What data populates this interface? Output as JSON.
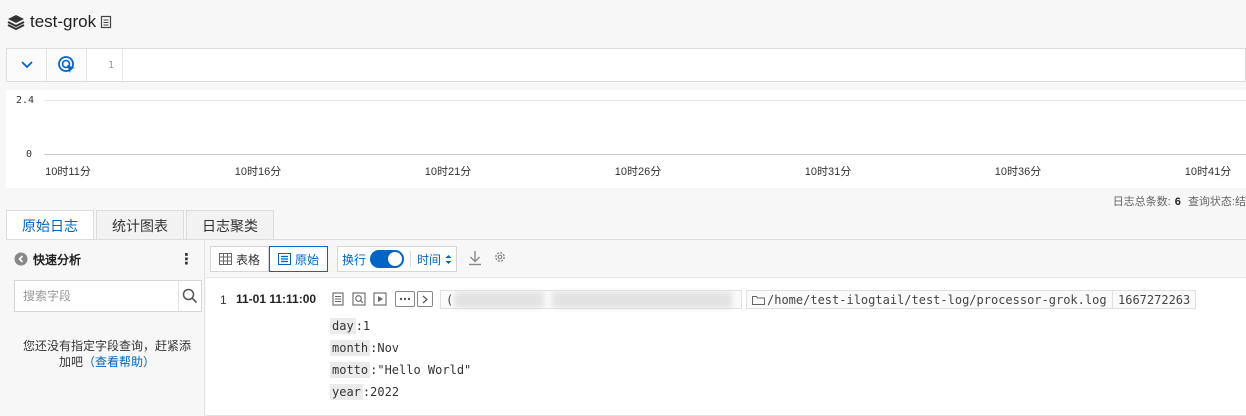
{
  "header": {
    "title": "test-grok"
  },
  "querybar": {
    "line_number": "1",
    "query": ""
  },
  "histogram": {
    "y_ticks": [
      "2.4",
      "0"
    ],
    "x_ticks": [
      "10时11分",
      "10时16分",
      "10时21分",
      "10时26分",
      "10时31分",
      "10时36分",
      "10时41分"
    ]
  },
  "stats": {
    "count_label": "日志总条数:",
    "count_value": "6",
    "status_label": "查询状态:",
    "status_value": "结"
  },
  "tabs": [
    {
      "label": "原始日志",
      "active": true
    },
    {
      "label": "统计图表",
      "active": false
    },
    {
      "label": "日志聚类",
      "active": false
    }
  ],
  "quick_analysis": {
    "title": "快速分析",
    "more": "⋮",
    "search_placeholder": "搜索字段",
    "empty_tip": "您还没有指定字段查询，赶紧添加吧",
    "help_link": "（查看帮助）"
  },
  "toolbar": {
    "table_label": "表格",
    "raw_label": "原始",
    "wrap_label": "换行",
    "wrap_on": true,
    "time_label": "时间",
    "accent_color": "#0064c8"
  },
  "log": {
    "row_number": "1",
    "time": "11-01 11:11:00",
    "source_prefix": "(",
    "path": "/home/test-ilogtail/test-log/processor-grok.log",
    "timestamp": "1667272263",
    "fields": [
      {
        "key": "day",
        "sep": ":",
        "value": "1"
      },
      {
        "key": "month",
        "sep": ":",
        "value": "Nov"
      },
      {
        "key": "motto",
        "sep": ":",
        "value": "\"Hello World\""
      },
      {
        "key": "year",
        "sep": ":",
        "value": "2022"
      }
    ]
  }
}
